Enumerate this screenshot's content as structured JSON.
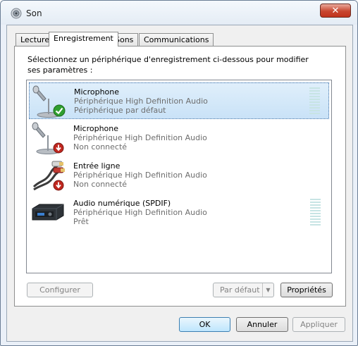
{
  "window": {
    "title": "Son",
    "close_glyph": "✕",
    "app_icon": "speaker-icon"
  },
  "tabs": [
    {
      "label": "Lecture"
    },
    {
      "label": "Enregistrement"
    },
    {
      "label": "Sons"
    },
    {
      "label": "Communications"
    }
  ],
  "panel": {
    "instructions": "Sélectionnez un périphérique d'enregistrement ci-dessous pour modifier ses paramètres :"
  },
  "devices": [
    {
      "name": "Microphone",
      "driver": "Périphérique High Definition Audio",
      "status": "Périphérique par défaut",
      "icon": "microphone-icon",
      "badge": "default-check-icon"
    },
    {
      "name": "Microphone",
      "driver": "Périphérique High Definition Audio",
      "status": "Non connecté",
      "icon": "microphone-icon",
      "badge": "unplugged-icon"
    },
    {
      "name": "Entrée ligne",
      "driver": "Périphérique High Definition Audio",
      "status": "Non connecté",
      "icon": "rca-cable-icon",
      "badge": "unplugged-icon"
    },
    {
      "name": "Audio numérique (SPDIF)",
      "driver": "Périphérique High Definition Audio",
      "status": "Prêt",
      "icon": "digital-audio-device-icon",
      "badge": ""
    }
  ],
  "buttons": {
    "configure": "Configurer",
    "set_default": "Par défaut",
    "properties": "Propriétés",
    "ok": "OK",
    "cancel": "Annuler",
    "apply": "Appliquer"
  },
  "colors": {
    "selection": "#cde6f7",
    "check_badge": "#2f9e2f",
    "unplugged_badge": "#c0271f",
    "close_button": "#c8462f"
  }
}
